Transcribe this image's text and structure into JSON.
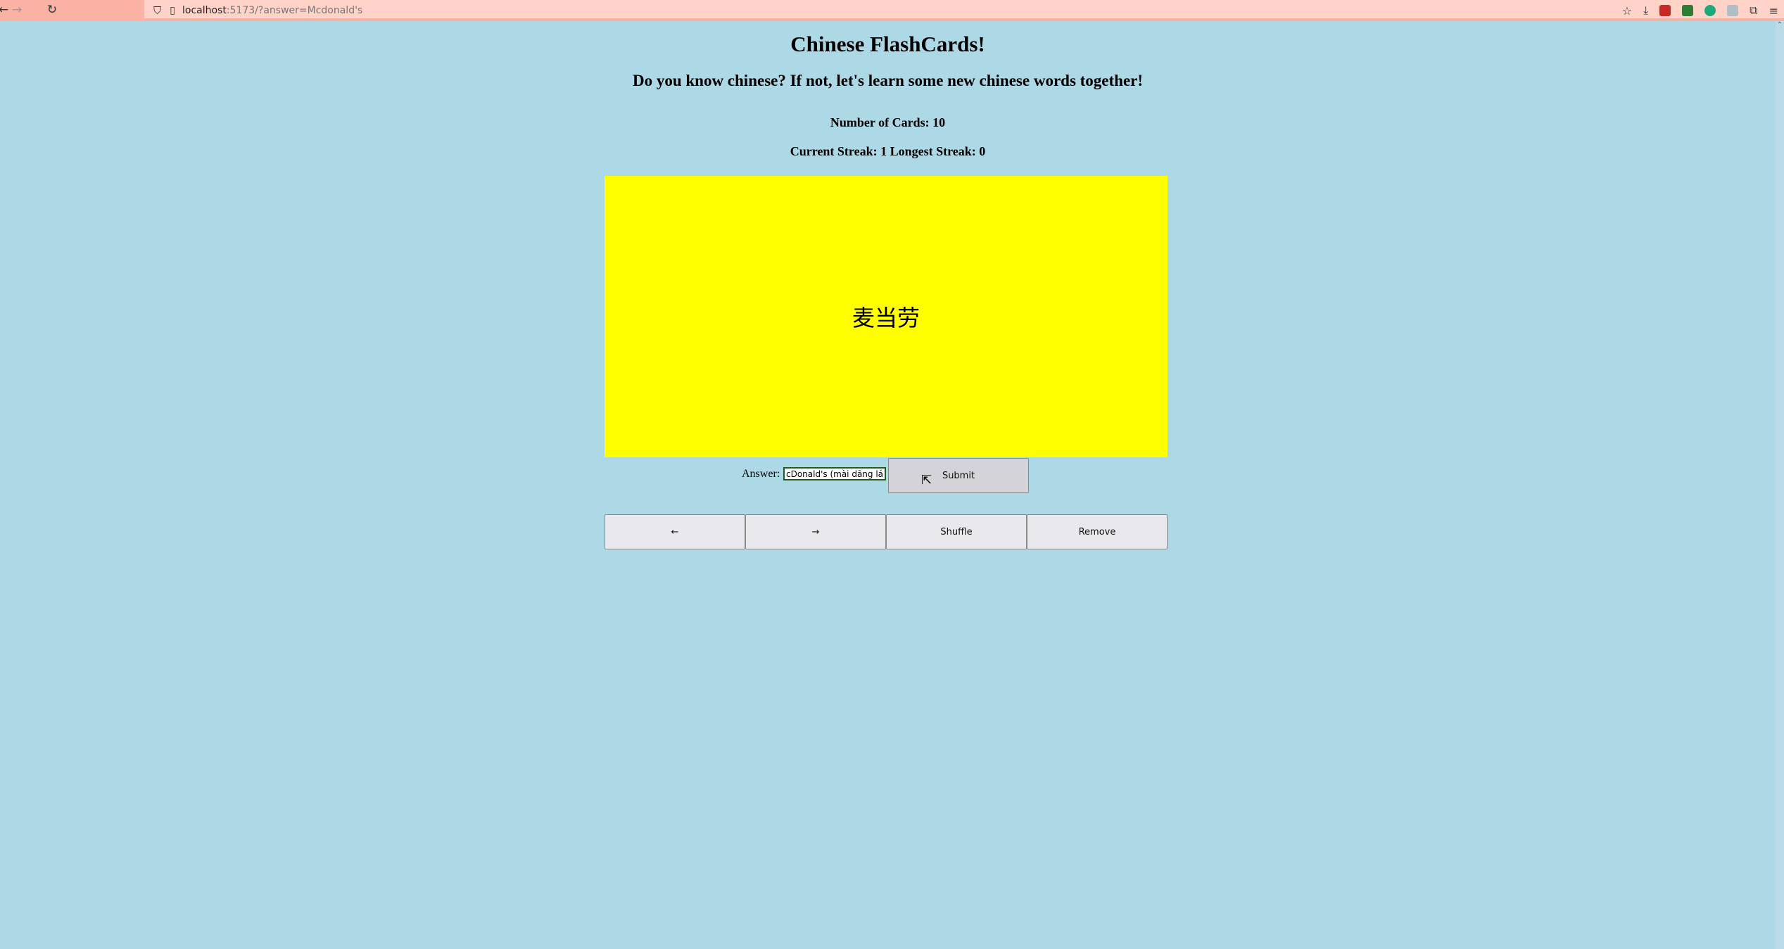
{
  "browser": {
    "url_host": "localhost",
    "url_rest": ":5173/?answer=Mcdonald's",
    "nav": {
      "back": "←",
      "forward": "→",
      "reload": "↻"
    }
  },
  "app": {
    "title": "Chinese FlashCards!",
    "subtitle": "Do you know chinese? If not, let's learn some new chinese words together!",
    "card_count_label": "Number of Cards: 10",
    "streak_label": "Current Streak: 1 Longest Streak: 0",
    "card_text": "麦当劳",
    "card_color": "#ffff00",
    "answer_label": "Answer:",
    "answer_value": "cDonald's (mài dāng láo)",
    "submit_label": "Submit",
    "prev_label": "←",
    "next_label": "→",
    "shuffle_label": "Shuffle",
    "remove_label": "Remove"
  },
  "colors": {
    "background": "#add8e6",
    "chrome": "#ffd3c8"
  }
}
